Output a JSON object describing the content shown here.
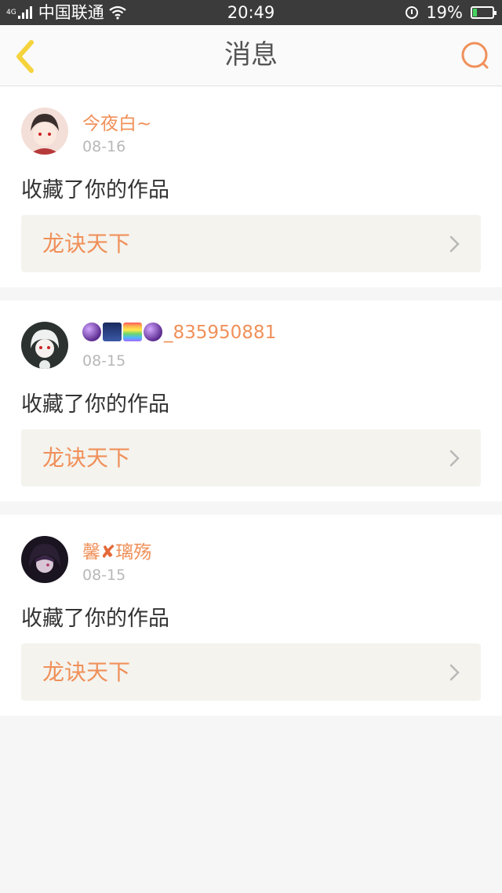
{
  "status_bar": {
    "network": "4G",
    "carrier": "中国联通",
    "time": "20:49",
    "battery": "19%",
    "battery_level": 0.19
  },
  "header": {
    "title": "消息",
    "back_icon": "chevron-left-icon",
    "search_icon": "search-icon"
  },
  "colors": {
    "accent": "#f0905a",
    "back_icon": "#f5d33c"
  },
  "messages": [
    {
      "username": "今夜白~",
      "date": "08-16",
      "action": "收藏了你的作品",
      "work_title": "龙诀天下"
    },
    {
      "username_suffix": "_835950881",
      "username_emojis": [
        "crystal-ball",
        "night-sky",
        "rainbow",
        "crystal-ball"
      ],
      "date": "08-15",
      "action": "收藏了你的作品",
      "work_title": "龙诀天下"
    },
    {
      "username_part1": "馨",
      "username_mark": "✘",
      "username_part2": "璃殇",
      "date": "08-15",
      "action": "收藏了你的作品",
      "work_title": "龙诀天下"
    }
  ]
}
